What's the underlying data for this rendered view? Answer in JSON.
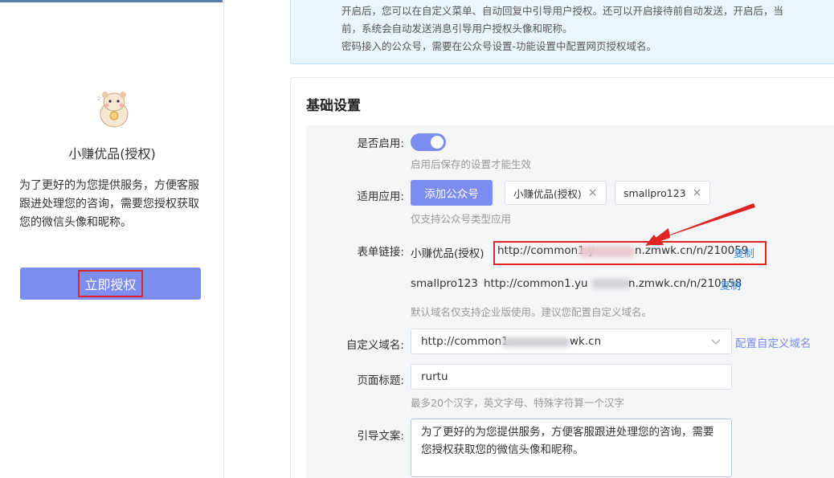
{
  "preview": {
    "app_name": "小赚优品(授权)",
    "intro": "为了更好的为您提供服务，方便客服跟进处理您的咨询，需要您授权获取您的微信头像和昵称。",
    "auth_button": "立即授权"
  },
  "info_box": {
    "line1": "开启后，您可以在自定义菜单、自动回复中引导用户授权。还可以开启接待前自动发送，开启后，当",
    "line2": "前，系统会自动发送消息引导用户授权头像和昵称。",
    "line3": "密码接入的公众号，需要在公众号设置-功能设置中配置网页授权域名。"
  },
  "basic_settings": {
    "title": "基础设置",
    "enable": {
      "label": "是否启用:",
      "on": true,
      "hint": "启用后保存的设置才能生效"
    },
    "apps": {
      "label": "适用应用:",
      "add_button": "添加公众号",
      "tags": [
        "小赚优品(授权)",
        "smallpro123"
      ],
      "remove_glyph": "×",
      "hint": "仅支持公众号类型应用"
    },
    "form_links": {
      "label": "表单链接:",
      "items": [
        {
          "app": "小赚优品(授权)",
          "url_start": "http://common1.y",
          "url_end": "n.zmwk.cn/n/210059",
          "copy": "复制"
        },
        {
          "app": "smallpro123",
          "url_start": "http://common1.yu",
          "url_end": "n.zmwk.cn/n/210158",
          "copy": "复制"
        }
      ],
      "hint": "默认域名仅支持企业版使用。建议您配置自定义域名。"
    },
    "custom_domain": {
      "label": "自定义域名:",
      "value_start": "http://common1.",
      "value_end": "wk.cn",
      "config_link": "配置自定义域名"
    },
    "page_title": {
      "label": "页面标题:",
      "value": "rurtu",
      "hint": "最多20个汉字，英文字母、特殊字符算一个汉字"
    },
    "guide_text": {
      "label": "引导文案:",
      "value": "为了更好的为您提供服务，方便客服跟进处理您的咨询，需要您授权获取您的微信头像和昵称。"
    }
  },
  "colors": {
    "accent": "#7d8cf0",
    "link": "#3a8ee6",
    "annotation_red": "#e02424",
    "info_bg": "#eaf6fd"
  }
}
